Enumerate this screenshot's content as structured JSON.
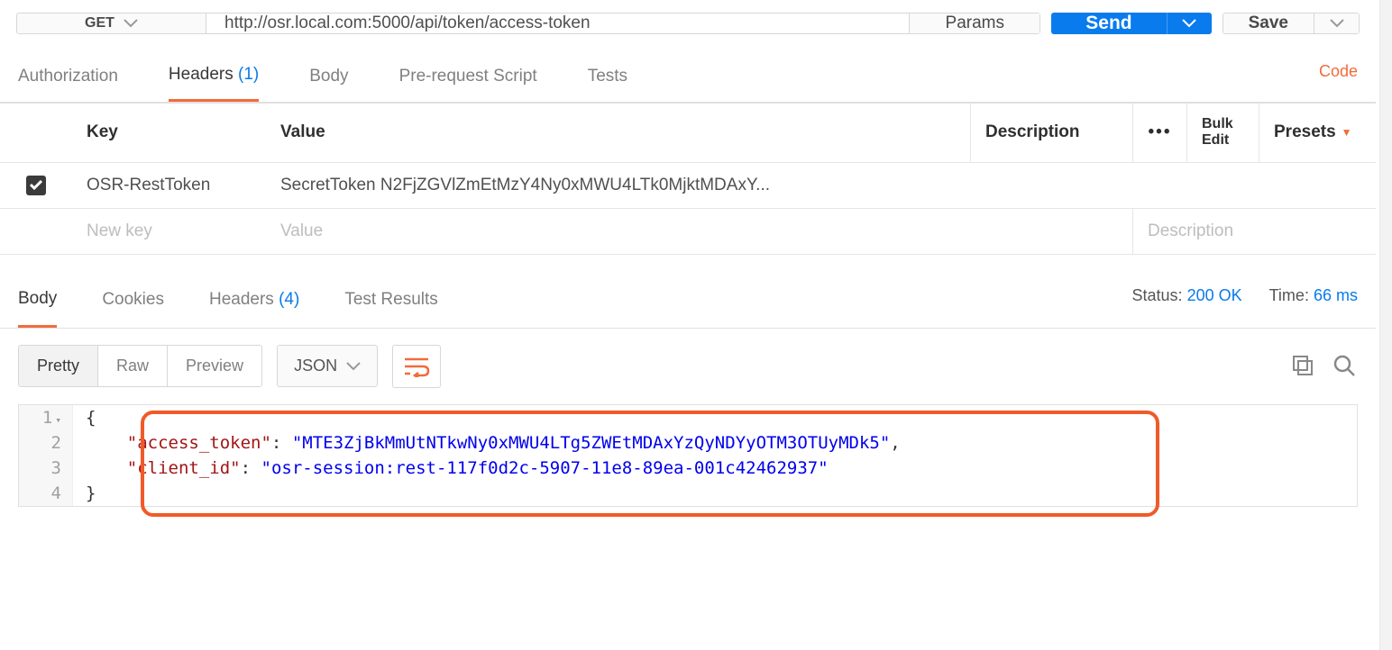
{
  "request": {
    "method": "GET",
    "url": "http://osr.local.com:5000/api/token/access-token",
    "params_label": "Params",
    "send_label": "Send",
    "save_label": "Save"
  },
  "req_tabs": {
    "authorization": "Authorization",
    "headers": "Headers",
    "headers_count": "(1)",
    "body": "Body",
    "prerequest": "Pre-request Script",
    "tests": "Tests",
    "code": "Code"
  },
  "headers_table": {
    "col_key": "Key",
    "col_value": "Value",
    "col_desc": "Description",
    "more": "•••",
    "bulk": "Bulk Edit",
    "presets": "Presets",
    "rows": [
      {
        "key": "OSR-RestToken",
        "value": "SecretToken N2FjZGVlZmEtMzY4Ny0xMWU4LTk0MjktMDAxY..."
      }
    ],
    "new_key_ph": "New key",
    "new_val_ph": "Value",
    "new_desc_ph": "Description"
  },
  "resp_tabs": {
    "body": "Body",
    "cookies": "Cookies",
    "headers": "Headers",
    "headers_count": "(4)",
    "test_results": "Test Results"
  },
  "status": {
    "label": "Status:",
    "value": "200 OK"
  },
  "time": {
    "label": "Time:",
    "value": "66 ms"
  },
  "viewer": {
    "pretty": "Pretty",
    "raw": "Raw",
    "preview": "Preview",
    "format": "JSON"
  },
  "response_body": {
    "access_token_key": "\"access_token\"",
    "access_token_val": "\"MTE3ZjBkMmUtNTkwNy0xMWU4LTg5ZWEtMDAxYzQyNDYyOTM3OTUyMDk5\"",
    "client_id_key": "\"client_id\"",
    "client_id_val": "\"osr-session:rest-117f0d2c-5907-11e8-89ea-001c42462937\""
  }
}
